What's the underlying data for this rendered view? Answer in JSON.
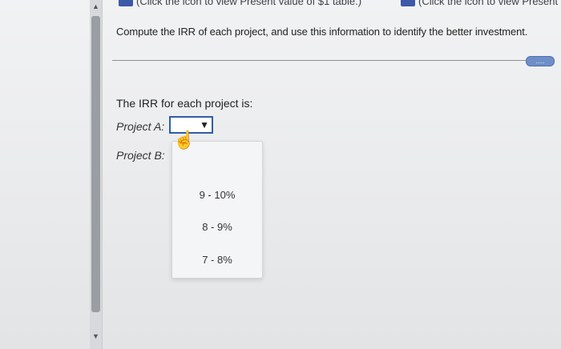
{
  "top_bar": {
    "left_link_text": "(Click the icon to view Present value of $1 table.)",
    "right_link_text": "(Click the icon to view Present"
  },
  "question": {
    "prompt": "Compute the IRR of each project, and use this information to identify the better investment.",
    "more_label": "....."
  },
  "irr": {
    "label": "The IRR for each project is:",
    "project_a_label": "Project A:",
    "project_b_label": "Project B:",
    "project_a_value": "",
    "dropdown_options": [
      "9 - 10%",
      "8 - 9%",
      "7 - 8%"
    ]
  },
  "icons": {
    "select_arrow": "▼",
    "hand": "☝",
    "scroll_up": "▲",
    "scroll_down": "▼"
  },
  "colors": {
    "accent": "#2f5da8",
    "icon_blue": "#3d5aa8"
  }
}
